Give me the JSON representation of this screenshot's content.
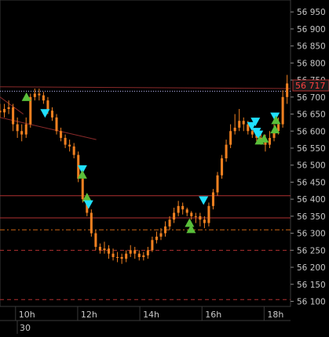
{
  "chart_data": {
    "type": "candlestick",
    "y_axis": {
      "position": "right",
      "ticks": [
        "56 950",
        "56 900",
        "56 850",
        "56 800",
        "56 750",
        "56 700",
        "56 650",
        "56 600",
        "56 550",
        "56 500",
        "56 450",
        "56 400",
        "56 350",
        "56 300",
        "56 250",
        "56 200",
        "56 150",
        "56 100"
      ],
      "tick_values": [
        56950,
        56900,
        56850,
        56800,
        56750,
        56700,
        56650,
        56600,
        56550,
        56500,
        56450,
        56400,
        56350,
        56300,
        56250,
        56200,
        56150,
        56100
      ],
      "range": [
        56085,
        56985
      ]
    },
    "x_axis": {
      "tick_labels": [
        "10h",
        "12h",
        "14h",
        "16h",
        "18h"
      ],
      "tick_hours": [
        10,
        12,
        14,
        16,
        18
      ],
      "date_label": "30",
      "range_hours": [
        9.5,
        18.85
      ]
    },
    "current_price": {
      "label": "56 717",
      "value": 56717
    },
    "reference_lines": [
      {
        "value": 56717,
        "style": "dotted",
        "color": "#c0c0ff"
      },
      {
        "value": 56410,
        "style": "solid",
        "color": "#b03030"
      },
      {
        "value": 56345,
        "style": "solid",
        "color": "#b03030"
      },
      {
        "value": 56310,
        "style": "dashdot",
        "color": "#c86414"
      },
      {
        "value": 56250,
        "style": "dashed",
        "color": "#b03030"
      },
      {
        "value": 56105,
        "style": "dashed",
        "color": "#b03030"
      }
    ],
    "trend_lines": [
      {
        "x": [
          9.5,
          10.25
        ],
        "y": [
          56700,
          56650
        ]
      },
      {
        "x": [
          9.5,
          12.6
        ],
        "y": [
          56640,
          56575
        ]
      },
      {
        "x": [
          9.5,
          18.85
        ],
        "y": [
          56730,
          56725
        ]
      }
    ],
    "series": {
      "t": [
        9.5,
        9.64,
        9.78,
        9.92,
        10.06,
        10.2,
        10.34,
        10.48,
        10.62,
        10.76,
        10.9,
        11.04,
        11.18,
        11.32,
        11.46,
        11.6,
        11.74,
        11.88,
        12.02,
        12.16,
        12.3,
        12.44,
        12.58,
        12.72,
        12.86,
        13.0,
        13.14,
        13.28,
        13.42,
        13.56,
        13.7,
        13.84,
        13.98,
        14.12,
        14.26,
        14.4,
        14.54,
        14.68,
        14.82,
        14.96,
        15.1,
        15.24,
        15.38,
        15.52,
        15.66,
        15.8,
        15.94,
        16.08,
        16.22,
        16.36,
        16.5,
        16.64,
        16.78,
        16.92,
        17.06,
        17.2,
        17.34,
        17.48,
        17.62,
        17.76,
        17.9,
        18.04,
        18.18,
        18.32,
        18.46,
        18.6,
        18.74
      ],
      "open": [
        56660,
        56655,
        56665,
        56670,
        56620,
        56600,
        56590,
        56620,
        56700,
        56710,
        56705,
        56690,
        56660,
        56640,
        56600,
        56580,
        56560,
        56555,
        56530,
        56460,
        56400,
        56360,
        56300,
        56260,
        56250,
        56255,
        56240,
        56230,
        56230,
        56225,
        56240,
        56250,
        56240,
        56230,
        56235,
        56250,
        56280,
        56290,
        56300,
        56320,
        56340,
        56360,
        56380,
        56370,
        56360,
        56350,
        56350,
        56340,
        56330,
        56380,
        56420,
        56470,
        56520,
        56560,
        56600,
        56610,
        56630,
        56620,
        56600,
        56590,
        56580,
        56570,
        56560,
        56580,
        56600,
        56620,
        56700
      ],
      "close": [
        56655,
        56665,
        56670,
        56620,
        56600,
        56590,
        56620,
        56700,
        56710,
        56705,
        56690,
        56660,
        56640,
        56600,
        56580,
        56560,
        56555,
        56530,
        56460,
        56400,
        56360,
        56300,
        56260,
        56250,
        56255,
        56240,
        56230,
        56230,
        56225,
        56240,
        56250,
        56240,
        56230,
        56235,
        56250,
        56280,
        56290,
        56300,
        56320,
        56340,
        56360,
        56380,
        56370,
        56360,
        56350,
        56350,
        56340,
        56330,
        56380,
        56420,
        56470,
        56520,
        56560,
        56600,
        56610,
        56630,
        56620,
        56600,
        56590,
        56580,
        56570,
        56560,
        56580,
        56600,
        56620,
        56700,
        56740
      ],
      "high": [
        56680,
        56680,
        56690,
        56680,
        56640,
        56620,
        56640,
        56710,
        56725,
        56725,
        56715,
        56700,
        56670,
        56650,
        56610,
        56590,
        56575,
        56565,
        56540,
        56470,
        56410,
        56370,
        56310,
        56270,
        56275,
        56265,
        56255,
        56245,
        56240,
        56250,
        56265,
        56260,
        56250,
        56245,
        56260,
        56290,
        56305,
        56315,
        56335,
        56350,
        56375,
        56395,
        56390,
        56375,
        56365,
        56360,
        56360,
        56350,
        56390,
        56430,
        56480,
        56530,
        56575,
        56620,
        56650,
        56665,
        56640,
        56630,
        56610,
        56600,
        56590,
        56590,
        56600,
        56620,
        56640,
        56720,
        56765
      ],
      "low": [
        56640,
        56640,
        56650,
        56600,
        56580,
        56570,
        56580,
        56610,
        56690,
        56690,
        56680,
        56650,
        56630,
        56590,
        56570,
        56550,
        56540,
        56520,
        56450,
        56390,
        56350,
        56290,
        56250,
        56240,
        56240,
        56225,
        56220,
        56215,
        56210,
        56215,
        56230,
        56225,
        56220,
        56220,
        56225,
        56245,
        56270,
        56280,
        56290,
        56310,
        56330,
        56350,
        56355,
        56350,
        56340,
        56330,
        56320,
        56315,
        56320,
        56370,
        56410,
        56460,
        56510,
        56550,
        56590,
        56600,
        56600,
        56590,
        56580,
        56570,
        56560,
        56540,
        56550,
        56570,
        56590,
        56610,
        56680
      ]
    },
    "markers": [
      {
        "t": 10.35,
        "value": 56700,
        "type": "buy"
      },
      {
        "t": 10.95,
        "value": 56653,
        "type": "sell"
      },
      {
        "t": 12.15,
        "value": 56488,
        "type": "sell"
      },
      {
        "t": 12.15,
        "value": 56472,
        "type": "buy"
      },
      {
        "t": 12.3,
        "value": 56405,
        "type": "buy"
      },
      {
        "t": 12.35,
        "value": 56385,
        "type": "sell"
      },
      {
        "t": 15.6,
        "value": 56330,
        "type": "buy"
      },
      {
        "t": 15.65,
        "value": 56312,
        "type": "buy"
      },
      {
        "t": 16.05,
        "value": 56397,
        "type": "sell"
      },
      {
        "t": 17.6,
        "value": 56615,
        "type": "sell"
      },
      {
        "t": 17.72,
        "value": 56628,
        "type": "sell"
      },
      {
        "t": 17.75,
        "value": 56598,
        "type": "sell"
      },
      {
        "t": 17.82,
        "value": 56590,
        "type": "sell"
      },
      {
        "t": 17.85,
        "value": 56572,
        "type": "buy"
      },
      {
        "t": 18.0,
        "value": 56578,
        "type": "buy"
      },
      {
        "t": 18.35,
        "value": 56643,
        "type": "sell"
      },
      {
        "t": 18.35,
        "value": 56605,
        "type": "buy"
      },
      {
        "t": 18.38,
        "value": 56632,
        "type": "buy"
      }
    ],
    "colors": {
      "background": "#000000",
      "candle": "#f08020",
      "buy_marker": "#5abf3a",
      "sell_marker": "#20e0ff",
      "grid": "#303030",
      "axis_text": "#c8c8c8",
      "price_label_bg": "#202020",
      "price_label_text": "#ff4040"
    }
  }
}
